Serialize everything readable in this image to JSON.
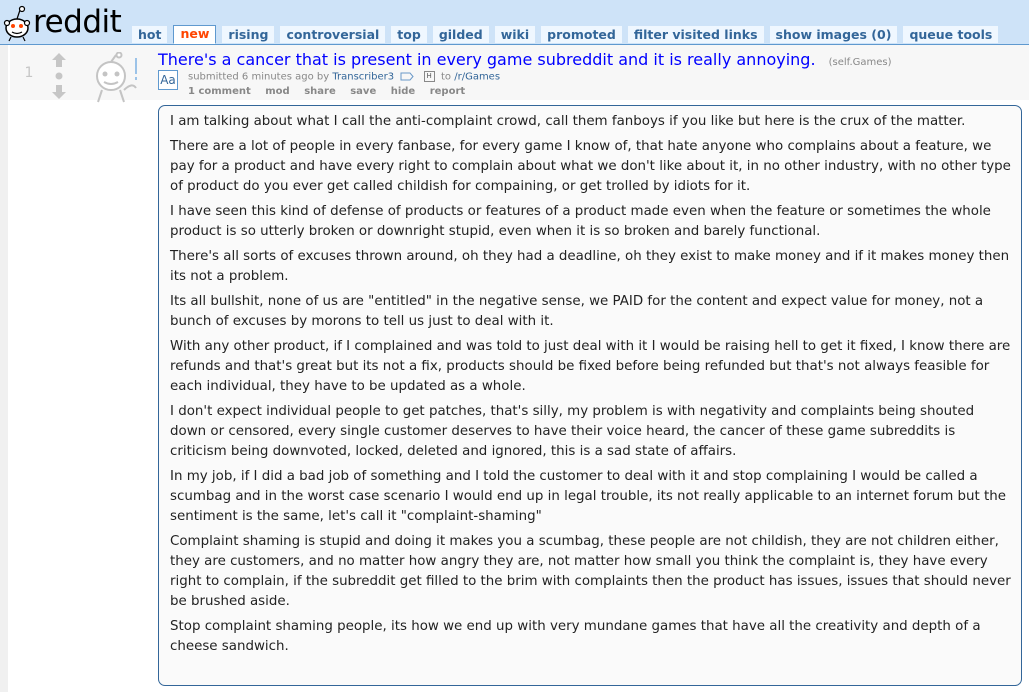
{
  "header": {
    "logo_text": "reddit",
    "tabs": [
      "hot",
      "new",
      "rising",
      "controversial",
      "top",
      "gilded",
      "wiki",
      "promoted",
      "filter visited links",
      "show images (0)",
      "queue tools"
    ],
    "selected_tab": "new"
  },
  "post": {
    "rank": "1",
    "title": "There's a cancer that is present in every game subreddit and it is really annoying.",
    "domain": "(self.Games)",
    "flair_icon": "Aa",
    "tagline": {
      "submitted": "submitted 6 minutes ago by",
      "author": "Transcriber3",
      "user_tag_icon": "H",
      "to": "to",
      "subreddit": "/r/Games"
    },
    "buttons": {
      "comments": "1 comment",
      "mod": "mod",
      "share": "share",
      "save": "save",
      "hide": "hide",
      "report": "report"
    },
    "selftext": [
      "I am talking about what I call the anti-complaint crowd, call them fanboys if you like but here is the crux of the matter.",
      "There are a lot of people in every fanbase, for every game I know of, that hate anyone who complains about a feature, we pay for a product and have every right to complain about what we don't like about it, in no other industry, with no other type of product do you ever get called childish for compaining, or get trolled by idiots for it.",
      "I have seen this kind of defense of products or features of a product made even when the feature or sometimes the whole product is so utterly broken or downright stupid, even when it is so broken and barely functional.",
      "There's all sorts of excuses thrown around, oh they had a deadline, oh they exist to make money and if it makes money then its not a problem.",
      "Its all bullshit, none of us are \"entitled\" in the negative sense, we PAID for the content and expect value for money, not a bunch of excuses by morons to tell us just to deal with it.",
      "With any other product, if I complained and was told to just deal with it I would be raising hell to get it fixed, I know there are refunds and that's great but its not a fix, products should be fixed before being refunded but that's not always feasible for each individual, they have to be updated as a whole.",
      "I don't expect individual people to get patches, that's silly, my problem is with negativity and complaints being shouted down or censored, every single customer deserves to have their voice heard, the cancer of these game subreddits is criticism being downvoted, locked, deleted and ignored, this is a sad state of affairs.",
      "In my job, if I did a bad job of something and I told the customer to deal with it and stop complaining I would be called a scumbag and in the worst case scenario I would end up in legal trouble, its not really applicable to an internet forum but the sentiment is the same, let's call it \"complaint-shaming\"",
      "Complaint shaming is stupid and doing it makes you a scumbag, these people are not childish, they are not children either, they are customers, and no matter how angry they are, not matter how small you think the complaint is, they have every right to complain, if the subreddit get filled to the brim with complaints then the product has issues, issues that should never be brushed aside.",
      "Stop complaint shaming people, its how we end up with very mundane games that have all the creativity and depth of a cheese sandwich."
    ]
  },
  "colors": {
    "header_bg": "#cee3f8",
    "link": "#0000ff",
    "accent": "#ff4500",
    "tab_text": "#336699"
  }
}
